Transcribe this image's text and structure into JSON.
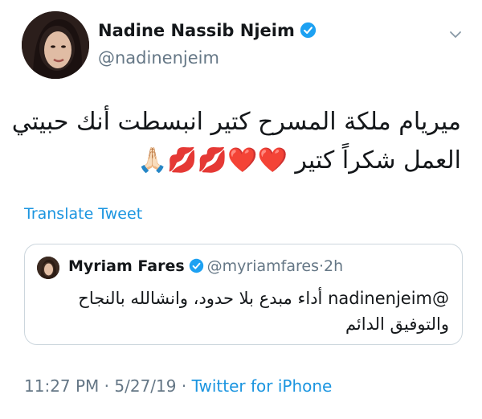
{
  "author": {
    "name": "Nadine Nassib Njeim",
    "handle": "@nadinenjeim"
  },
  "icons": {
    "verified": "verified-badge-icon",
    "menu": "chevron-down-icon"
  },
  "tweet": {
    "line1": "ميريام ملكة المسرح كتير انبسطت أنك حبيتي",
    "line2": "العمل شكراً كتير ❤️❤️💋💋🙏🏻"
  },
  "translate_label": "Translate Tweet",
  "quote": {
    "name": "Myriam Fares",
    "handle": "@myriamfares",
    "separator": "·",
    "time": "2h",
    "line1": "@nadinenjeim أداء مبدع بلا حدود، وانشالله بالنجاح",
    "line2": "والتوفيق الدائم"
  },
  "meta": {
    "time": "11:27 PM",
    "sep1": " · ",
    "date": "5/27/19",
    "sep2": " · ",
    "source": "Twitter for iPhone"
  },
  "colors": {
    "link": "#1b95e0",
    "secondary": "#657786",
    "text": "#14171a",
    "border": "#ccd6dd"
  }
}
